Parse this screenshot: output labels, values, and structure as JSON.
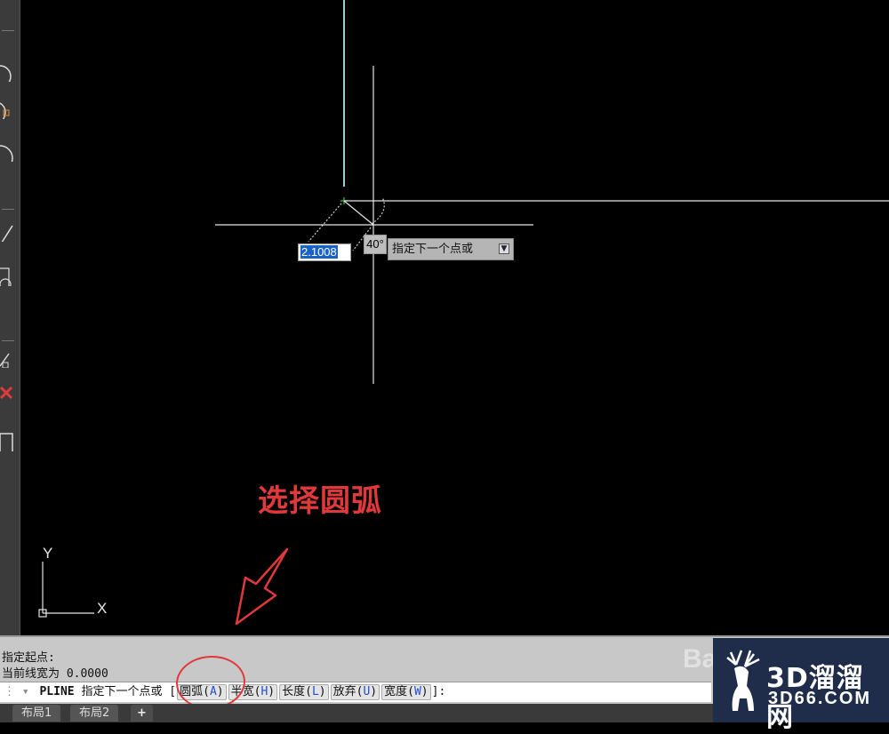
{
  "canvas": {
    "dynamic_input_value": "2.1008",
    "angle_label": "40°",
    "prompt_tooltip": "指定下一个点或",
    "ucs_y_label": "Y",
    "ucs_x_label": "X"
  },
  "annotation": {
    "text": "选择圆弧"
  },
  "command_history": [
    "指定起点:",
    "当前线宽为 0.0000"
  ],
  "command_line": {
    "command": "PLINE",
    "prompt": "指定下一个点或",
    "open_bracket": "[",
    "options": [
      {
        "label": "圆弧",
        "key": "A"
      },
      {
        "label": "半宽",
        "key": "H"
      },
      {
        "label": "长度",
        "key": "L"
      },
      {
        "label": "放弃",
        "key": "U"
      },
      {
        "label": "宽度",
        "key": "W"
      }
    ],
    "close_bracket": "]:"
  },
  "tabs": [
    "布局1",
    "布局2",
    "+"
  ],
  "watermarks": {
    "logo_cn": "3D溜溜网",
    "logo_en": "3D66.COM",
    "baidu": "Ba"
  },
  "colors": {
    "canvas_bg": "#000000",
    "crosshair": "#e6e6e6",
    "annotation_red": "#e0393c",
    "selection_blue": "#1a63c6"
  }
}
